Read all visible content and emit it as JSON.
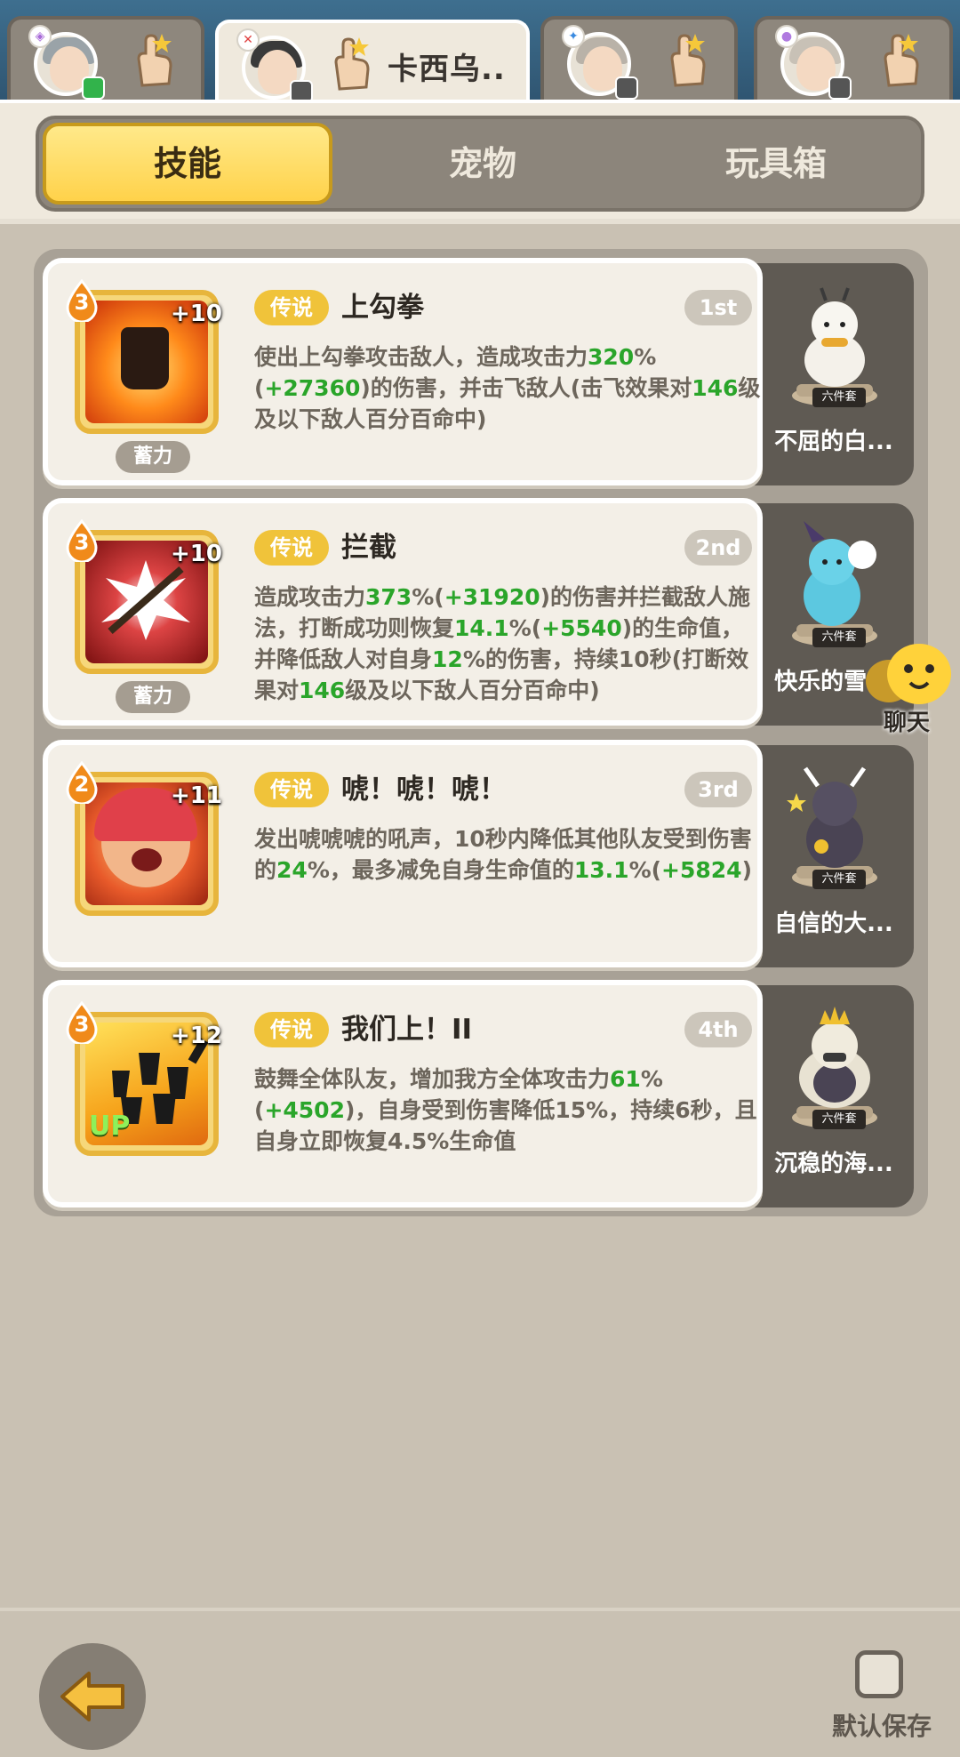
{
  "hero_tabs": [
    {
      "element": "purple",
      "active": false,
      "name": ""
    },
    {
      "element": "red",
      "active": true,
      "name": "卡西乌.."
    },
    {
      "element": "blue",
      "active": false,
      "name": ""
    },
    {
      "element": "violet",
      "active": false,
      "name": ""
    }
  ],
  "categories": {
    "skills": "技能",
    "pets": "宠物",
    "toybox": "玩具箱",
    "active": "skills"
  },
  "skills": [
    {
      "level": "3",
      "plus": "+10",
      "rarity": "传说",
      "name": "上勾拳",
      "order": "1st",
      "charge": "蓄力",
      "desc_parts": [
        {
          "t": "使出上勾拳攻击敌人，造成攻击力"
        },
        {
          "t": "320",
          "g": true
        },
        {
          "t": "%("
        },
        {
          "t": "+27360",
          "g": true
        },
        {
          "t": ")的伤害，并击飞敌人(击飞效果对"
        },
        {
          "t": "146",
          "g": true
        },
        {
          "t": "级及以下敌人百分百命中)"
        }
      ],
      "pet_name": "不屈的白...",
      "set_tag": "六件套"
    },
    {
      "level": "3",
      "plus": "+10",
      "rarity": "传说",
      "name": "拦截",
      "order": "2nd",
      "charge": "蓄力",
      "desc_parts": [
        {
          "t": "造成攻击力"
        },
        {
          "t": "373",
          "g": true
        },
        {
          "t": "%("
        },
        {
          "t": "+31920",
          "g": true
        },
        {
          "t": ")的伤害并拦截敌人施法，打断成功则恢复"
        },
        {
          "t": "14.1",
          "g": true
        },
        {
          "t": "%("
        },
        {
          "t": "+5540",
          "g": true
        },
        {
          "t": ")的生命值，并降低敌人对自身"
        },
        {
          "t": "12",
          "g": true
        },
        {
          "t": "%的伤害，持续10秒(打断效果对"
        },
        {
          "t": "146",
          "g": true
        },
        {
          "t": "级及以下敌人百分百命中)"
        }
      ],
      "pet_name": "快乐的雪...",
      "set_tag": "六件套"
    },
    {
      "level": "2",
      "plus": "+11",
      "rarity": "传说",
      "name": "唬！唬！唬！",
      "order": "3rd",
      "charge": "",
      "desc_parts": [
        {
          "t": "发出唬唬唬的吼声，10秒内降低其他队友受到伤害的"
        },
        {
          "t": "24",
          "g": true
        },
        {
          "t": "%，最多减免自身生命值的"
        },
        {
          "t": "13.1",
          "g": true
        },
        {
          "t": "%("
        },
        {
          "t": "+5824",
          "g": true
        },
        {
          "t": ")"
        }
      ],
      "pet_name": "自信的大...",
      "set_tag": "六件套"
    },
    {
      "level": "3",
      "plus": "+12",
      "rarity": "传说",
      "name": "我们上！II",
      "order": "4th",
      "charge": "",
      "up": "UP",
      "desc_parts": [
        {
          "t": "鼓舞全体队友，增加我方全体攻击力"
        },
        {
          "t": "61",
          "g": true
        },
        {
          "t": "%("
        },
        {
          "t": "+4502",
          "g": true
        },
        {
          "t": ")，自身受到伤害降低15%，持续6秒，且自身立即恢复4.5%生命值"
        }
      ],
      "pet_name": "沉稳的海...",
      "set_tag": "六件套"
    }
  ],
  "chat": {
    "label": "聊天"
  },
  "bottom": {
    "save_label": "默认保存"
  }
}
